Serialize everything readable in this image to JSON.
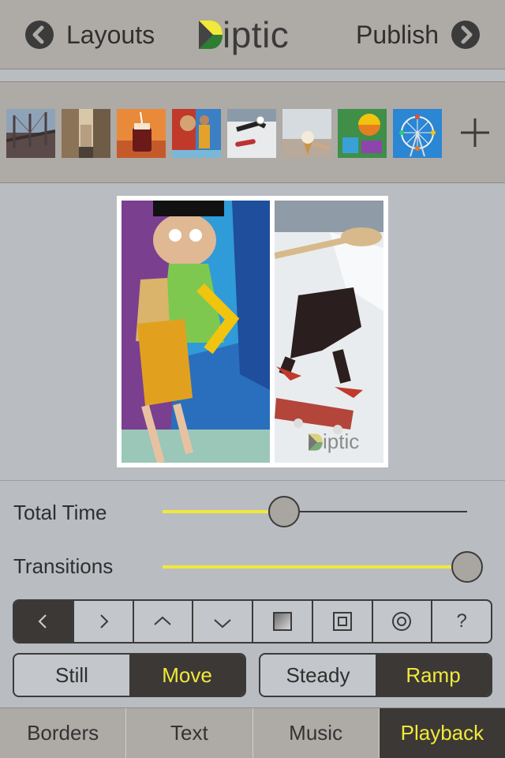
{
  "navbar": {
    "back_label": "Layouts",
    "forward_label": "Publish",
    "logo_text": "iptic"
  },
  "thumbnails": [
    {
      "name": "bridge"
    },
    {
      "name": "city-street"
    },
    {
      "name": "drink"
    },
    {
      "name": "graffiti"
    },
    {
      "name": "skater"
    },
    {
      "name": "ice-cream"
    },
    {
      "name": "playground"
    },
    {
      "name": "ferris-wheel"
    }
  ],
  "canvas": {
    "watermark_text": "iptic"
  },
  "sliders": {
    "total_time": {
      "label": "Total Time",
      "value": 0.4
    },
    "transitions": {
      "label": "Transitions",
      "value": 1.0
    }
  },
  "direction_buttons": {
    "help_label": "?",
    "selected": "left"
  },
  "motion_mode": {
    "still": "Still",
    "move": "Move",
    "selected": "Move"
  },
  "speed_mode": {
    "steady": "Steady",
    "ramp": "Ramp",
    "selected": "Ramp"
  },
  "tabs": {
    "borders": "Borders",
    "text": "Text",
    "music": "Music",
    "playback": "Playback",
    "active": "Playback"
  },
  "colors": {
    "accent_yellow": "#f2e83a",
    "dark": "#3b3836",
    "panel": "#aeaaa6",
    "background": "#b9bdc2"
  }
}
